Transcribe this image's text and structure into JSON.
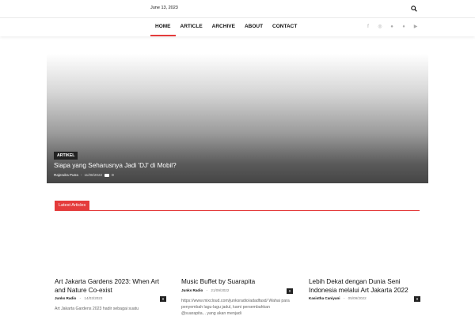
{
  "topbar": {
    "date": "June 13, 2023"
  },
  "nav": {
    "items": [
      "HOME",
      "ARTICLE",
      "ARCHIVE",
      "ABOUT",
      "CONTACT"
    ],
    "active_index": 0
  },
  "social_icons": [
    "facebook-icon",
    "instagram-icon",
    "reddit-icon",
    "twitter-icon",
    "youtube-icon"
  ],
  "hero": {
    "category": "ARTIKEL",
    "title": "Siapa yang Seharusnya Jadi 'DJ' di Mobil?",
    "author": "Rajendra Putra",
    "date": "11/08/2022",
    "comments": "0"
  },
  "section": {
    "label": "Latest Articles"
  },
  "articles": [
    {
      "title": "Art Jakarta Gardens 2023: When Art and Nature Co-exist",
      "author": "Junks Radio",
      "date": "14/03/2023",
      "comments": "0",
      "excerpt": "Art Jakarta Gardens 2023 hadir sebagai suatu"
    },
    {
      "title": "Music Buffet by Suarapita",
      "author": "Junks Radio",
      "date": "21/09/2022",
      "comments": "0",
      "excerpt": "https://www.mixcloud.com/junksradio/adadfasd/ Wahai para penyembah lagu-lagu jadul, kami persembahkan @suarapita... yang akan menjadi"
    },
    {
      "title": "Lebih Dekat dengan Dunia Seni Indonesia melalui Art Jakarta 2022",
      "author": "Kasistha Caniyani",
      "date": "05/09/2022",
      "comments": "0",
      "excerpt": ""
    }
  ],
  "colors": {
    "accent": "#e43b3b",
    "dark": "#222222"
  }
}
